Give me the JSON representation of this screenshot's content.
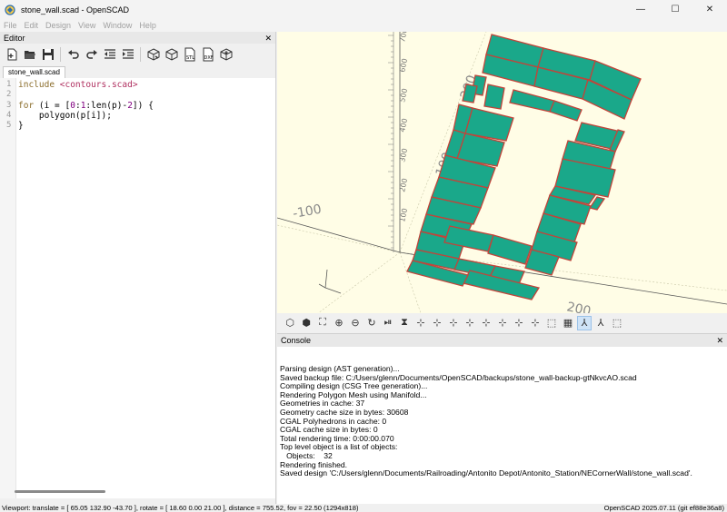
{
  "window": {
    "title": "stone_wall.scad - OpenSCAD",
    "minimize": "—",
    "maximize": "☐",
    "close": "✕"
  },
  "menu": [
    "File",
    "Edit",
    "Design",
    "View",
    "Window",
    "Help"
  ],
  "editor": {
    "panel_title": "Editor",
    "close": "✕",
    "tab": "stone_wall.scad",
    "lines": [
      {
        "num": "1",
        "parts": [
          [
            "kw",
            "include "
          ],
          [
            "str",
            "<contours.scad>"
          ]
        ]
      },
      {
        "num": "2",
        "parts": []
      },
      {
        "num": "3",
        "parts": [
          [
            "kw",
            "for"
          ],
          [
            "",
            " (i = ["
          ],
          [
            "num",
            "0"
          ],
          [
            "",
            ":"
          ],
          [
            "num",
            "1"
          ],
          [
            "",
            ":len(p)-"
          ],
          [
            "num",
            "2"
          ],
          [
            "",
            "]) {"
          ]
        ]
      },
      {
        "num": "4",
        "parts": [
          [
            "",
            "    polygon(p[i]);"
          ]
        ]
      },
      {
        "num": "5",
        "parts": [
          [
            "",
            "}"
          ]
        ]
      }
    ],
    "toolbar_icons": [
      "new-file-icon",
      "open-file-icon",
      "save-icon",
      "undo-icon",
      "redo-icon",
      "unindent-icon",
      "indent-icon",
      "preview-icon",
      "render-icon",
      "export-stl-icon",
      "export-dxf-icon",
      "send-to-printer-icon"
    ]
  },
  "viewport": {
    "axis_labels": {
      "x_neg": "-100",
      "x_pos_100": "100",
      "x_pos_200": "200",
      "y_100": "100",
      "y_200": "200"
    },
    "ruler_ticks": [
      "700",
      "600",
      "500",
      "400",
      "300",
      "200",
      "100"
    ],
    "bg_color": "#fffde6",
    "stone_color": "#1aa88a",
    "mortar_color": "#c1443a"
  },
  "view_toolbar_icons": [
    "preview-cube-icon",
    "render-cube-icon",
    "view-all-icon",
    "zoom-in-icon",
    "zoom-out-icon",
    "reset-view-icon",
    "animate-icon",
    "perspective-toggle-icon",
    "view-right-icon",
    "view-top-icon",
    "view-bottom-icon",
    "view-left-icon",
    "view-front-icon",
    "view-back-icon",
    "view-diagonal-icon",
    "view-center-icon",
    "perspective-icon",
    "orthogonal-icon",
    "show-axes-icon",
    "show-scale-icon",
    "show-edges-icon"
  ],
  "console": {
    "panel_title": "Console",
    "close": "✕",
    "lines": [
      "Parsing design (AST generation)...",
      "Saved backup file: C:/Users/glenn/Documents/OpenSCAD/backups/stone_wall-backup-gtNkvcAO.scad",
      "Compiling design (CSG Tree generation)...",
      "Rendering Polygon Mesh using Manifold...",
      "Geometries in cache: 37",
      "Geometry cache size in bytes: 30608",
      "CGAL Polyhedrons in cache: 0",
      "CGAL cache size in bytes: 0",
      "Total rendering time: 0:00:00.070",
      "Top level object is a list of objects:",
      "   Objects:    32",
      "Rendering finished.",
      "Saved design 'C:/Users/glenn/Documents/Railroading/Antonito Depot/Antonito_Station/NECornerWall/stone_wall.scad'."
    ]
  },
  "status": {
    "viewport": "Viewport: translate = [ 65.05 132.90 -43.70 ], rotate = [ 18.60 0.00 21.00 ], distance = 755.52, fov = 22.50 (1294x818)",
    "version": "OpenSCAD 2025.07.11 (git ef88e36a8)"
  }
}
